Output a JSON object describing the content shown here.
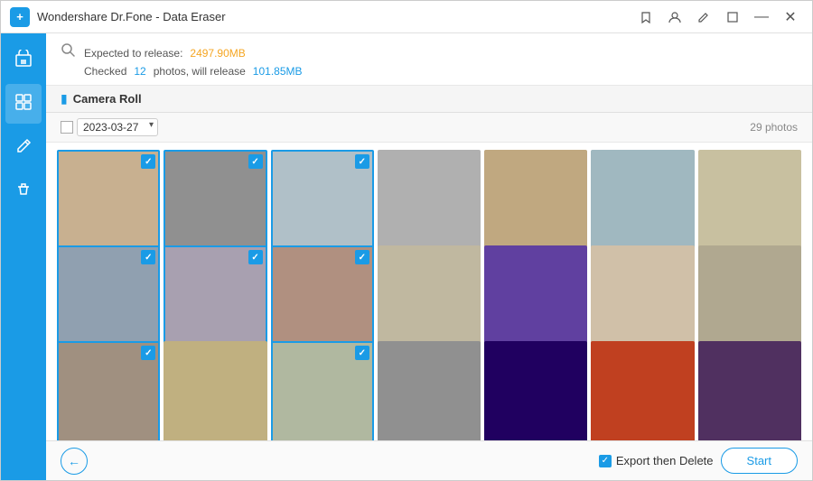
{
  "titlebar": {
    "title": "Wondershare Dr.Fone - Data Eraser",
    "logo_text": "+"
  },
  "info": {
    "expected_label": "Expected to release:",
    "expected_value": "2497.90MB",
    "checked_prefix": "Checked",
    "checked_count": "12",
    "checked_mid": "photos, will release",
    "checked_value": "101.85MB"
  },
  "section": {
    "title": "Camera Roll"
  },
  "filter": {
    "date": "2023-03-27",
    "photo_count": "29 photos"
  },
  "photos": [
    {
      "id": 1,
      "checked": true,
      "color": "p1"
    },
    {
      "id": 2,
      "checked": true,
      "color": "p2"
    },
    {
      "id": 3,
      "checked": true,
      "color": "p3"
    },
    {
      "id": 4,
      "checked": false,
      "color": "p4"
    },
    {
      "id": 5,
      "checked": false,
      "color": "p5"
    },
    {
      "id": 6,
      "checked": false,
      "color": "p6"
    },
    {
      "id": 7,
      "checked": false,
      "color": "p7"
    },
    {
      "id": 8,
      "checked": true,
      "color": "p8"
    },
    {
      "id": 9,
      "checked": true,
      "color": "p9"
    },
    {
      "id": 10,
      "checked": true,
      "color": "p10"
    },
    {
      "id": 11,
      "checked": false,
      "color": "p11"
    },
    {
      "id": 12,
      "checked": false,
      "color": "p12"
    },
    {
      "id": 13,
      "checked": false,
      "color": "p13"
    },
    {
      "id": 14,
      "checked": false,
      "color": "p14"
    },
    {
      "id": 15,
      "checked": true,
      "color": "p1"
    },
    {
      "id": 16,
      "checked": false,
      "color": "p2"
    },
    {
      "id": 17,
      "checked": true,
      "color": "p3"
    },
    {
      "id": 18,
      "checked": false,
      "color": "p4"
    },
    {
      "id": 19,
      "checked": false,
      "color": "p13"
    },
    {
      "id": 20,
      "checked": false,
      "color": "p15"
    },
    {
      "id": 21,
      "checked": false,
      "color": "p16"
    }
  ],
  "bottom": {
    "export_label": "Export then Delete",
    "start_label": "Start"
  },
  "sidebar": {
    "items": [
      {
        "id": "home",
        "icon": "⊞",
        "label": ""
      },
      {
        "id": "erase",
        "icon": "▦",
        "label": ""
      },
      {
        "id": "edit",
        "icon": "✎",
        "label": ""
      },
      {
        "id": "clean",
        "icon": "⊘",
        "label": ""
      }
    ]
  }
}
